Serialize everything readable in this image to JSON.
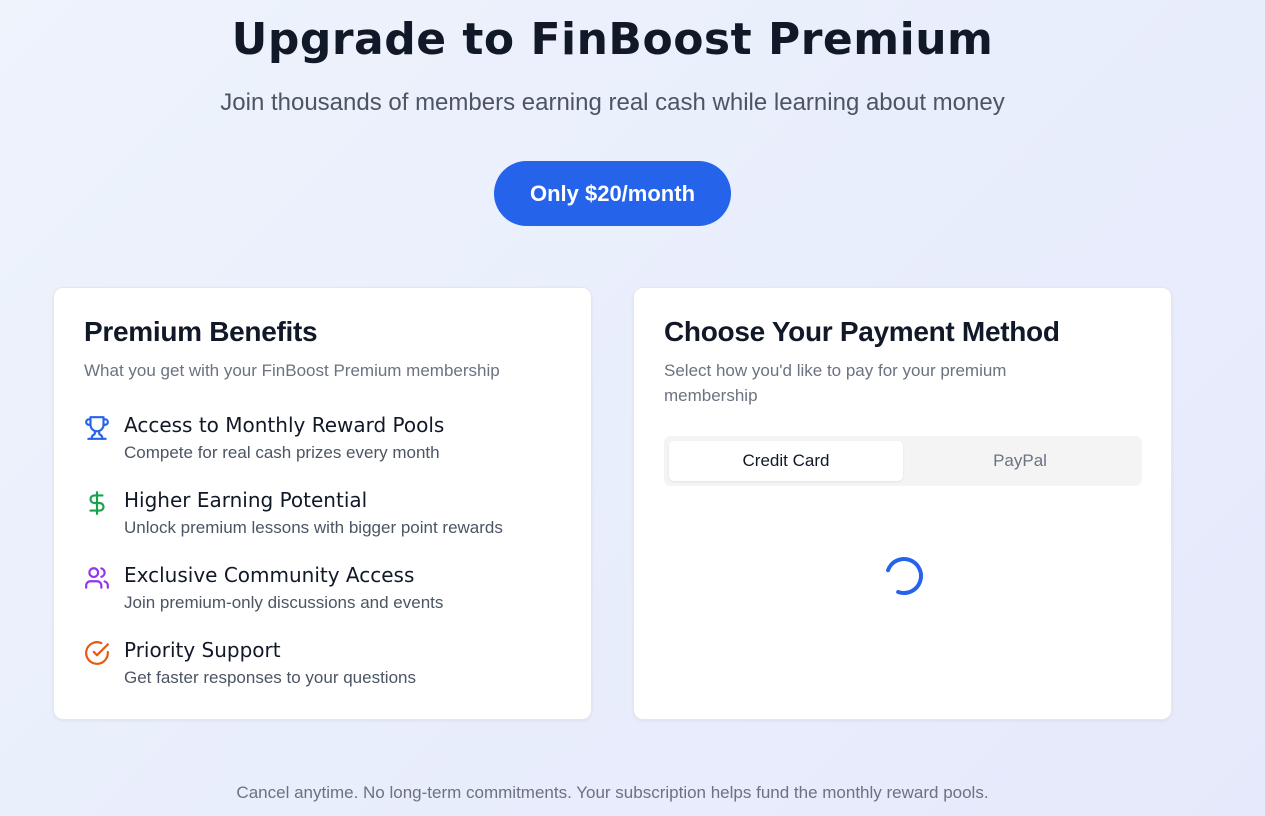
{
  "header": {
    "title": "Upgrade to FinBoost Premium",
    "subtitle": "Join thousands of members earning real cash while learning about money",
    "price_label": "Only $20/month"
  },
  "benefits": {
    "title": "Premium Benefits",
    "subtitle": "What you get with your FinBoost Premium membership",
    "items": [
      {
        "icon": "trophy-icon",
        "color": "#2563eb",
        "title": "Access to Monthly Reward Pools",
        "description": "Compete for real cash prizes every month"
      },
      {
        "icon": "dollar-sign-icon",
        "color": "#16a34a",
        "title": "Higher Earning Potential",
        "description": "Unlock premium lessons with bigger point rewards"
      },
      {
        "icon": "users-icon",
        "color": "#9333ea",
        "title": "Exclusive Community Access",
        "description": "Join premium-only discussions and events"
      },
      {
        "icon": "check-circle-icon",
        "color": "#ea580c",
        "title": "Priority Support",
        "description": "Get faster responses to your questions"
      }
    ]
  },
  "payment": {
    "title": "Choose Your Payment Method",
    "subtitle": "Select how you'd like to pay for your premium membership",
    "tabs": [
      {
        "label": "Credit Card",
        "active": true
      },
      {
        "label": "PayPal",
        "active": false
      }
    ],
    "loading_icon": "spinner-icon"
  },
  "footer": {
    "note": "Cancel anytime. No long-term commitments. Your subscription helps fund the monthly reward pools."
  },
  "colors": {
    "accent": "#2563eb",
    "background": "#eaf0fc"
  }
}
